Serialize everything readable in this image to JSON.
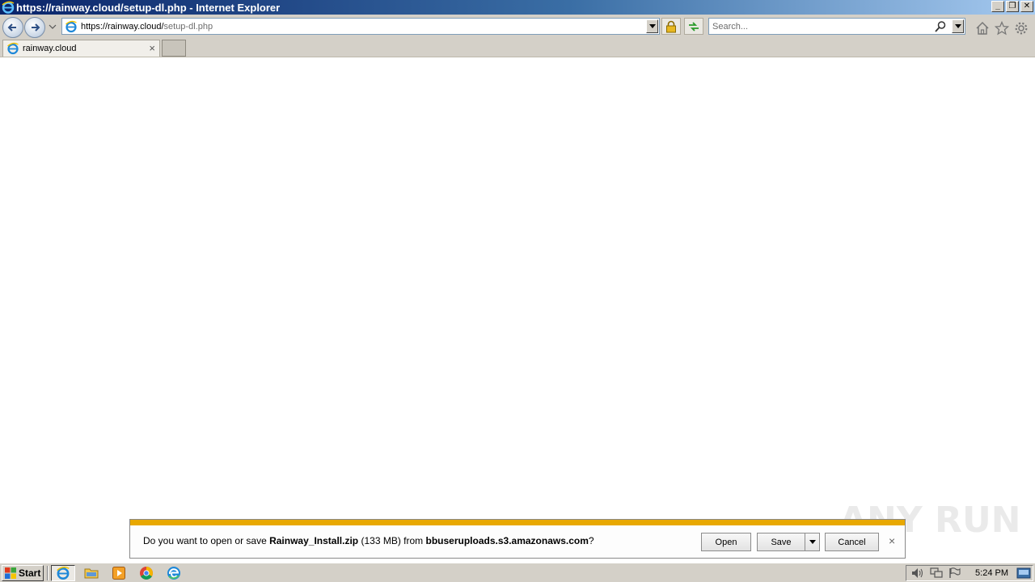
{
  "window": {
    "title": "https://rainway.cloud/setup-dl.php - Internet Explorer",
    "controls": {
      "minimize": "_",
      "restore": "❐",
      "close": "✕"
    }
  },
  "navbar": {
    "url_host": "https://rainway.cloud/",
    "url_path": "setup-dl.php",
    "search_placeholder": "Search..."
  },
  "tabs": [
    {
      "label": "rainway.cloud",
      "close": "×"
    }
  ],
  "download_bar": {
    "prefix": "Do you want to open or save ",
    "filename": "Rainway_Install.zip",
    "size": " (133 MB) from ",
    "source": "bbuseruploads.s3.amazonaws.com",
    "suffix": "?",
    "open_label": "Open",
    "save_label": "Save",
    "cancel_label": "Cancel",
    "close": "×",
    "accent_color": "#e8a800"
  },
  "watermark": {
    "text": "ANY RUN"
  },
  "taskbar": {
    "start_label": "Start",
    "apps": [
      "ie-icon",
      "folder-icon",
      "media-player-icon",
      "chrome-icon",
      "edge-icon"
    ],
    "clock": "5:24 PM"
  }
}
